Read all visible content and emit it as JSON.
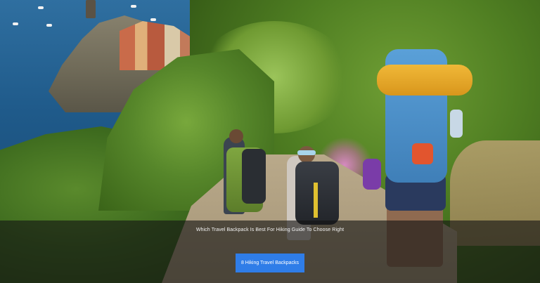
{
  "hero": {
    "image_name": "hero-hiking-image",
    "caption": "Which Travel Backpack Is Best For Hiking Guide To Choose Right",
    "cta_label": "8 Hiking Travel Backpacks"
  },
  "colors": {
    "overlay": "#141414",
    "button": "#2f7de8",
    "caption_text": "#f4f4f4"
  }
}
